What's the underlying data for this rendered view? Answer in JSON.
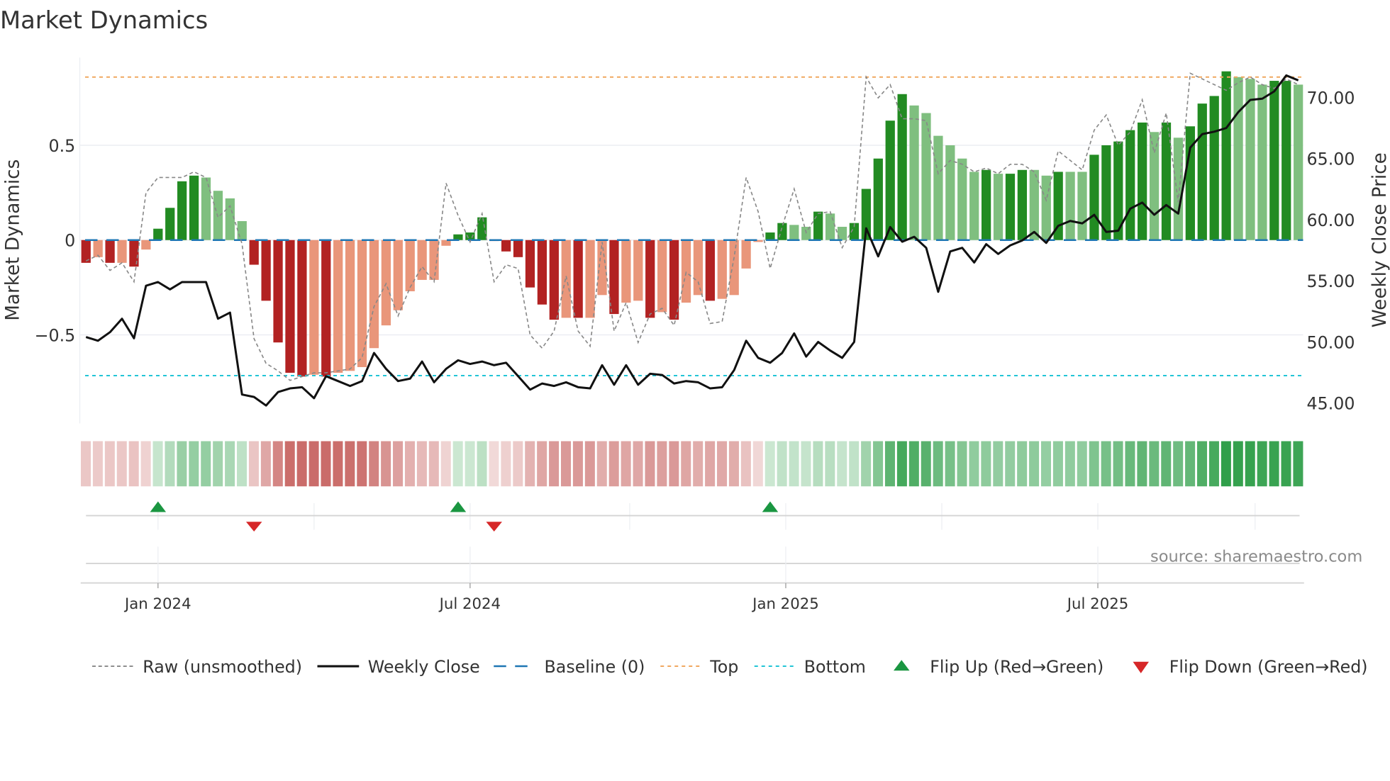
{
  "chart_data": {
    "type": "bar",
    "title": "Market Dynamics",
    "ylabel": "Market Dynamics",
    "y2label": "Weekly Close Price",
    "ylim": [
      -0.97,
      0.97
    ],
    "y2lim": [
      43.4,
      73.3
    ],
    "yticks": [
      {
        "v": 0.5,
        "label": "0.5"
      },
      {
        "v": 0,
        "label": "0"
      },
      {
        "v": -0.5,
        "label": "−0.5"
      }
    ],
    "y2ticks": [
      {
        "v": 45,
        "label": "45.00"
      },
      {
        "v": 50,
        "label": "50.00"
      },
      {
        "v": 55,
        "label": "55.00"
      },
      {
        "v": 60,
        "label": "60.00"
      },
      {
        "v": 65,
        "label": "65.00"
      },
      {
        "v": 70,
        "label": "70.00"
      }
    ],
    "xticks": [
      {
        "week": 6,
        "label": "Jan 2024"
      },
      {
        "week": 32,
        "label": "Jul 2024"
      },
      {
        "week": 58.3,
        "label": "Jan 2025"
      },
      {
        "week": 84.3,
        "label": "Jul 2025"
      }
    ],
    "quarter_grid_weeks": [
      6,
      19,
      32,
      45.3,
      58.3,
      71.3,
      84.3,
      97.4
    ],
    "top_level": 0.86,
    "bottom_level": -0.715,
    "baseline": 0,
    "smoothed": [
      -0.12,
      -0.09,
      -0.12,
      -0.12,
      -0.14,
      -0.05,
      0.06,
      0.17,
      0.31,
      0.34,
      0.33,
      0.26,
      0.22,
      0.1,
      -0.13,
      -0.32,
      -0.54,
      -0.7,
      -0.72,
      -0.71,
      -0.72,
      -0.7,
      -0.69,
      -0.67,
      -0.57,
      -0.45,
      -0.37,
      -0.27,
      -0.21,
      -0.21,
      -0.03,
      0.03,
      0.04,
      0.12,
      -0.005,
      -0.06,
      -0.09,
      -0.25,
      -0.34,
      -0.42,
      -0.41,
      -0.41,
      -0.41,
      -0.29,
      -0.39,
      -0.33,
      -0.32,
      -0.41,
      -0.38,
      -0.42,
      -0.33,
      -0.29,
      -0.32,
      -0.31,
      -0.29,
      -0.15,
      -0.01,
      0.04,
      0.09,
      0.08,
      0.07,
      0.15,
      0.14,
      0.07,
      0.09,
      0.27,
      0.43,
      0.63,
      0.77,
      0.71,
      0.67,
      0.55,
      0.5,
      0.43,
      0.36,
      0.37,
      0.35,
      0.35,
      0.37,
      0.37,
      0.34,
      0.36,
      0.36,
      0.36,
      0.45,
      0.5,
      0.52,
      0.58,
      0.62,
      0.57,
      0.62,
      0.54,
      0.6,
      0.72,
      0.76,
      0.89,
      0.86,
      0.85,
      0.82,
      0.84,
      0.84,
      0.82
    ],
    "strong": [
      1,
      0,
      1,
      0,
      1,
      0,
      1,
      1,
      1,
      1,
      0,
      0,
      0,
      0,
      1,
      1,
      1,
      1,
      1,
      0,
      1,
      0,
      0,
      0,
      0,
      0,
      0,
      0,
      0,
      0,
      0,
      1,
      1,
      1,
      1,
      1,
      1,
      1,
      1,
      1,
      0,
      1,
      0,
      0,
      1,
      0,
      0,
      1,
      0,
      1,
      0,
      0,
      1,
      0,
      0,
      0,
      0,
      1,
      1,
      0,
      0,
      1,
      0,
      0,
      1,
      1,
      1,
      1,
      1,
      0,
      0,
      0,
      0,
      0,
      0,
      1,
      0,
      1,
      1,
      0,
      0,
      1,
      0,
      0,
      1,
      1,
      1,
      1,
      1,
      0,
      1,
      0,
      1,
      1,
      1,
      1,
      0,
      0,
      0,
      1,
      1,
      0
    ],
    "raw": [
      -0.11,
      -0.08,
      -0.16,
      -0.12,
      -0.22,
      0.25,
      0.33,
      0.33,
      0.33,
      0.36,
      0.33,
      0.12,
      0.18,
      -0.02,
      -0.52,
      -0.65,
      -0.69,
      -0.74,
      -0.72,
      -0.7,
      -0.7,
      -0.69,
      -0.68,
      -0.62,
      -0.35,
      -0.23,
      -0.4,
      -0.25,
      -0.14,
      -0.22,
      0.3,
      0.13,
      -0.01,
      0.14,
      -0.22,
      -0.13,
      -0.15,
      -0.5,
      -0.57,
      -0.48,
      -0.19,
      -0.48,
      -0.56,
      -0.01,
      -0.48,
      -0.33,
      -0.54,
      -0.39,
      -0.36,
      -0.45,
      -0.17,
      -0.22,
      -0.44,
      -0.43,
      -0.09,
      0.33,
      0.15,
      -0.15,
      0.07,
      0.27,
      0.04,
      0.14,
      0.15,
      -0.04,
      0.07,
      0.86,
      0.75,
      0.82,
      0.64,
      0.64,
      0.63,
      0.35,
      0.42,
      0.4,
      0.36,
      0.38,
      0.35,
      0.4,
      0.4,
      0.36,
      0.21,
      0.47,
      0.42,
      0.37,
      0.58,
      0.66,
      0.5,
      0.57,
      0.74,
      0.46,
      0.67,
      0.2,
      0.88,
      0.85,
      0.82,
      0.79,
      0.83,
      0.86,
      0.82,
      0.8,
      0.85,
      0.82
    ],
    "close": [
      50.4,
      50.1,
      50.8,
      51.9,
      50.3,
      54.6,
      54.9,
      54.3,
      54.9,
      54.9,
      54.9,
      51.9,
      52.4,
      45.7,
      45.5,
      44.8,
      45.9,
      46.2,
      46.3,
      45.4,
      47.2,
      46.8,
      46.4,
      46.8,
      49.1,
      47.8,
      46.8,
      47.0,
      48.4,
      46.7,
      47.8,
      48.5,
      48.2,
      48.4,
      48.1,
      48.3,
      47.2,
      46.1,
      46.6,
      46.4,
      46.7,
      46.3,
      46.2,
      48.1,
      46.5,
      48.1,
      46.5,
      47.4,
      47.3,
      46.6,
      46.8,
      46.7,
      46.2,
      46.3,
      47.7,
      50.1,
      48.7,
      48.3,
      49.1,
      50.7,
      48.8,
      50.0,
      49.3,
      48.7,
      50.0,
      59.3,
      57.0,
      59.4,
      58.2,
      58.6,
      57.7,
      54.1,
      57.4,
      57.7,
      56.5,
      58.0,
      57.2,
      57.9,
      58.3,
      59.0,
      58.1,
      59.5,
      59.9,
      59.7,
      60.4,
      59.0,
      59.1,
      60.9,
      61.4,
      60.4,
      61.2,
      60.5,
      65.9,
      67.0,
      67.2,
      67.5,
      68.8,
      69.8,
      69.9,
      70.5,
      71.8,
      71.4
    ],
    "flip_up_weeks": [
      6,
      31,
      57
    ],
    "flip_down_weeks": [
      14,
      34
    ],
    "legend": {
      "raw": "Raw (unsmoothed)",
      "close": "Weekly Close",
      "baseline": "Baseline (0)",
      "top": "Top",
      "bottom": "Bottom",
      "flip_up": "Flip Up (Red→Green)",
      "flip_down": "Flip Down (Green→Red)"
    },
    "legend_placement": "bottom",
    "source": "source: sharemaestro.com",
    "colors": {
      "green_strong": "#228b22",
      "green_weak": "#7fbf7f",
      "red_strong": "#b22222",
      "red_weak": "#e9967a",
      "baseline": "#1f77b4",
      "top": "#f0a860",
      "bottom": "#22c5d6",
      "raw": "#888888",
      "close": "#111111",
      "flip_up": "#1a9641",
      "flip_down": "#d62728",
      "heat_green": "#2e9e48",
      "heat_red": "#c0504d"
    }
  }
}
